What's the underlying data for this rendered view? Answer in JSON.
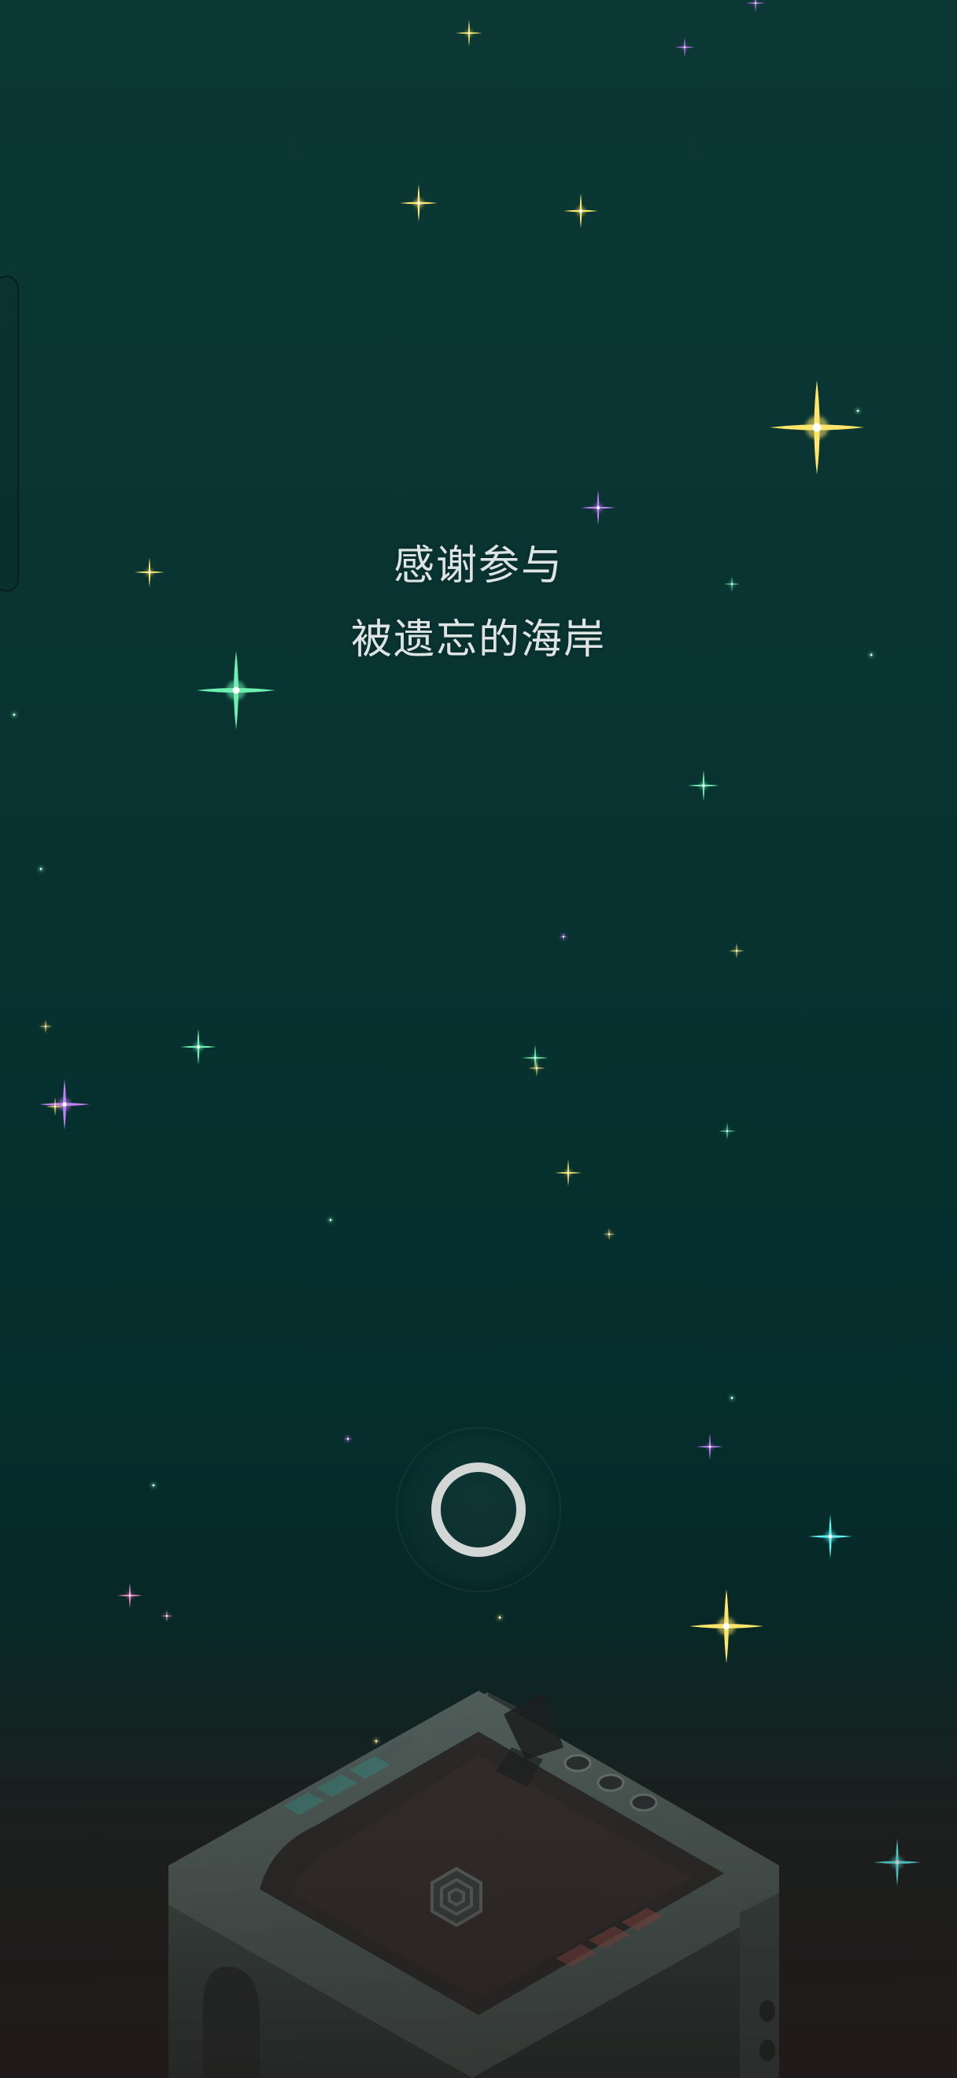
{
  "credits": {
    "line1": "感谢参与",
    "line2": "被遗忘的海岸"
  },
  "colors": {
    "background_top": "#0b3734",
    "background_bottom": "#231b1a",
    "text": "#dde4e3",
    "ring": "#d2d6d4",
    "star_yellow": "#ffe66b",
    "star_green": "#6ef0b0",
    "star_violet": "#c77cff",
    "star_cyan": "#5ff2f2",
    "star_pink": "#ff8fd8"
  },
  "icons": {
    "continue": "ring-icon",
    "decor": "sacred-geometry-cube",
    "background": "starfield"
  }
}
